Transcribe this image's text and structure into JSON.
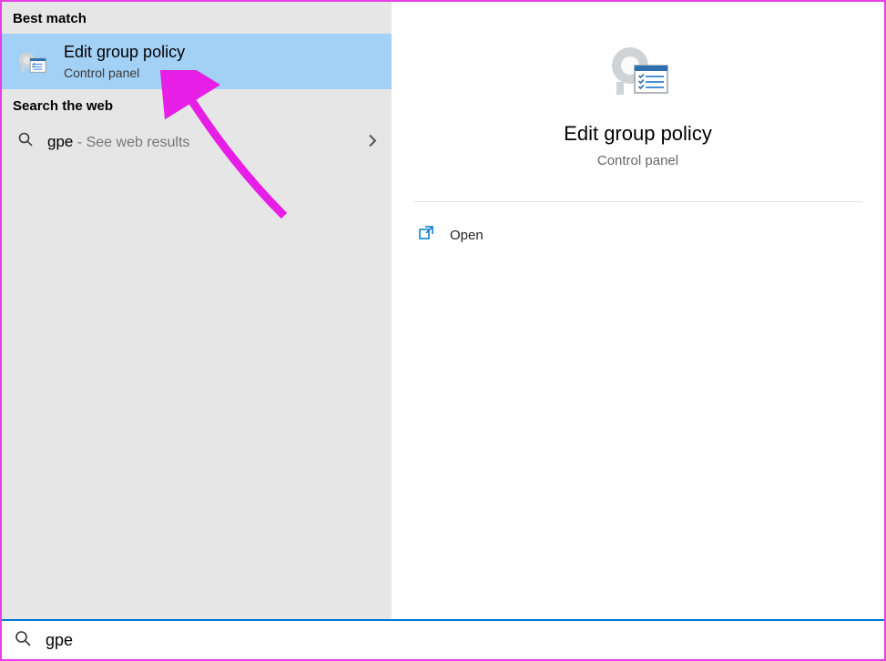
{
  "left": {
    "best_match_header": "Best match",
    "result": {
      "title": "Edit group policy",
      "subtitle": "Control panel"
    },
    "web_header": "Search the web",
    "web_item": {
      "query": "gpe",
      "hint": " - See web results"
    }
  },
  "preview": {
    "title": "Edit group policy",
    "subtitle": "Control panel",
    "actions": {
      "open": "Open"
    }
  },
  "search": {
    "value": "gpe",
    "placeholder": ""
  },
  "colors": {
    "selection": "#a3d0f5",
    "accent": "#0078d4",
    "annotation": "#e83ee8"
  }
}
